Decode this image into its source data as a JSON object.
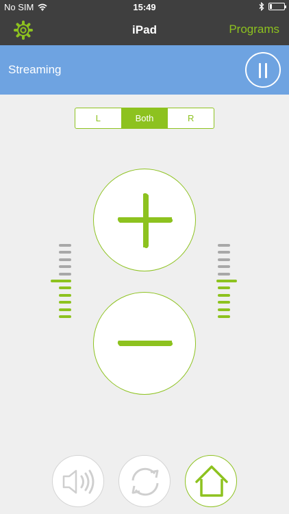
{
  "status_bar": {
    "carrier": "No SIM",
    "time": "15:49",
    "battery_level": 0.15
  },
  "nav": {
    "title": "iPad",
    "programs_label": "Programs",
    "settings_icon": "gear-icon"
  },
  "streaming": {
    "label": "Streaming",
    "pause_icon": "pause-icon"
  },
  "side_selector": {
    "options": [
      "L",
      "Both",
      "R"
    ],
    "selected": "Both"
  },
  "volume": {
    "up_icon": "plus-icon",
    "down_icon": "minus-icon",
    "left_level": 6,
    "right_level": 6,
    "total_ticks": 11
  },
  "bottom_bar": {
    "speaker_icon": "speaker-icon",
    "sync_icon": "sync-icon",
    "home_icon": "home-icon"
  },
  "colors": {
    "accent": "#8dc21f",
    "header": "#3f3f3f",
    "streaming_bar": "#6ea3e1",
    "inactive_tick": "#a8a8a8",
    "background": "#efefef"
  }
}
